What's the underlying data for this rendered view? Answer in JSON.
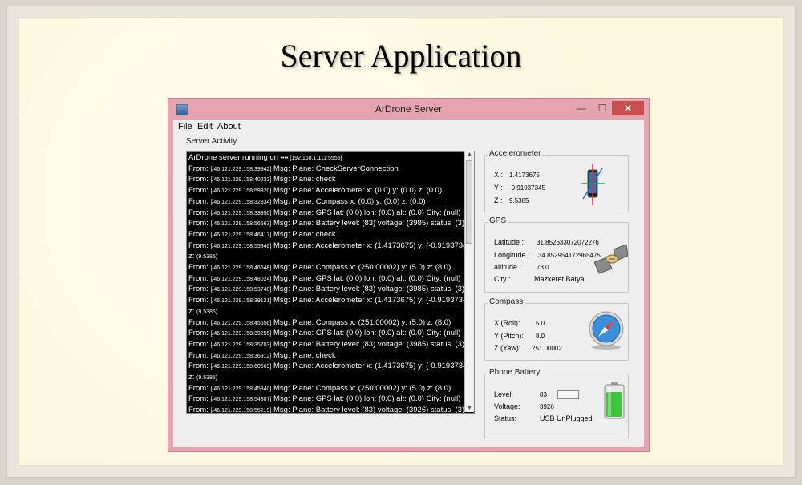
{
  "slide": {
    "title": "Server Application"
  },
  "window": {
    "title": "ArDrone Server",
    "controls": {
      "minimize": "—",
      "maximize": "☐",
      "close": "✕"
    }
  },
  "menu": {
    "items": [
      "File",
      "Edit",
      "About"
    ]
  },
  "server_activity": {
    "label": "Server Activity",
    "lines": [
      [
        "ArDrone server running on ",
        "•••• [192.168.1.111:5555]",
        ""
      ],
      [
        "From: ",
        "[/46.121.229.158:39942]",
        "  Msg: Plane: CheckServerConnection"
      ],
      [
        "From: ",
        "[/46.121.229.158:40233]",
        "  Msg: Plane: check"
      ],
      [
        "From: ",
        "[/46.121.229.158:59320]",
        "  Msg: Plane: Accelerometer x: (0.0) y: (0.0) z: (0.0)"
      ],
      [
        "From: ",
        "[/46.121.229.158:32834]",
        "  Msg: Plane: Compass x: (0.0) y: (0.0) z: (0.0)"
      ],
      [
        "From: ",
        "[/46.121.229.158:33950]",
        "  Msg: Plane: GPS lat: (0.0) lon: (0.0) alt: (0.0) City: (null)"
      ],
      [
        "From: ",
        "[/46.121.229.158:56563]",
        "  Msg: Plane: Battery level: (83) voltage: (3985) status: (3)"
      ],
      [
        "From: ",
        "[/46.121.229.158:46417]",
        "  Msg: Plane: check"
      ],
      [
        "From: ",
        "[/46.121.229.158:55846]",
        "  Msg: Plane: Accelerometer x: (1.4173675) y: (-0.91937345)"
      ],
      [
        "z: ",
        "(9.5385)",
        ""
      ],
      [
        "From: ",
        "[/46.121.229.158:46648]",
        "  Msg: Plane: Compass x: (250.00002) y: (5.0) z: (8.0)"
      ],
      [
        "From: ",
        "[/46.121.229.158:48024]",
        "  Msg: Plane: GPS lat: (0.0) lon: (0.0) alt: (0.0) City: (null)"
      ],
      [
        "From: ",
        "[/46.121.229.158:53740]",
        "  Msg: Plane: Battery level: (83) voltage: (3985) status: (3)"
      ],
      [
        "From: ",
        "[/46.121.229.158:39121]",
        "  Msg: Plane: Accelerometer x: (1.4173675) y: (-0.91937345)"
      ],
      [
        "z: ",
        "(9.5385)",
        ""
      ],
      [
        "From: ",
        "[/46.121.229.158:45656]",
        "  Msg: Plane: Compass x: (251.00002) y: (5.0) z: (8.0)"
      ],
      [
        "From: ",
        "[/46.121.229.158:39255]",
        "  Msg: Plane: GPS lat: (0.0) lon: (0.0) alt: (0.0) City: (null)"
      ],
      [
        "From: ",
        "[/46.121.229.158:35703]",
        "  Msg: Plane: Battery level: (83) voltage: (3985) status: (3)"
      ],
      [
        "From: ",
        "[/46.121.229.158:36912]",
        "  Msg: Plane: check"
      ],
      [
        "From: ",
        "[/46.121.229.158:60669]",
        "  Msg: Plane: Accelerometer x: (1.4173675) y: (-0.91937345)"
      ],
      [
        "z: ",
        "(9.5385)",
        ""
      ],
      [
        "From: ",
        "[/46.121.229.158:45340]",
        "  Msg: Plane: Compass x: (250.00002) y: (5.0) z: (8.0)"
      ],
      [
        "From: ",
        "[/46.121.229.158:54807]",
        "  Msg: Plane: GPS lat: (0.0) lon: (0.0) alt: (0.0) City: (null)"
      ],
      [
        "From: ",
        "[/46.121.229.158:55219]",
        "  Msg: Plane: Battery level: (83) voltage: (3926) status: (3)"
      ]
    ]
  },
  "accelerometer": {
    "title": "Accelerometer",
    "rows": [
      {
        "label": "X :",
        "value": "1.4173675"
      },
      {
        "label": "Y :",
        "value": "-0.91937345"
      },
      {
        "label": "Z :",
        "value": "9.5385"
      }
    ]
  },
  "gps": {
    "title": "GPS",
    "rows": [
      {
        "label": "Latitude :",
        "value": "31.852633072072276"
      },
      {
        "label": "Longitude :",
        "value": "34.852954172965475"
      },
      {
        "label": "altitude :",
        "value": "73.0"
      },
      {
        "label": "City :",
        "value": "Mazkeret Batya"
      }
    ]
  },
  "compass": {
    "title": "Compass",
    "rows": [
      {
        "label": "X (Roll):",
        "value": "5.0"
      },
      {
        "label": "Y (Pitch):",
        "value": "8.0"
      },
      {
        "label": "Z (Yaw):",
        "value": "251.00002"
      }
    ]
  },
  "battery": {
    "title": "Phone Battery",
    "level_label": "Level:",
    "level_value": "83",
    "level_fraction": 0.83,
    "voltage_label": "Voltage:",
    "voltage_value": "3926",
    "status_label": "Status:",
    "status_value": "USB UnPlugged",
    "accent": "#3fc43f"
  }
}
